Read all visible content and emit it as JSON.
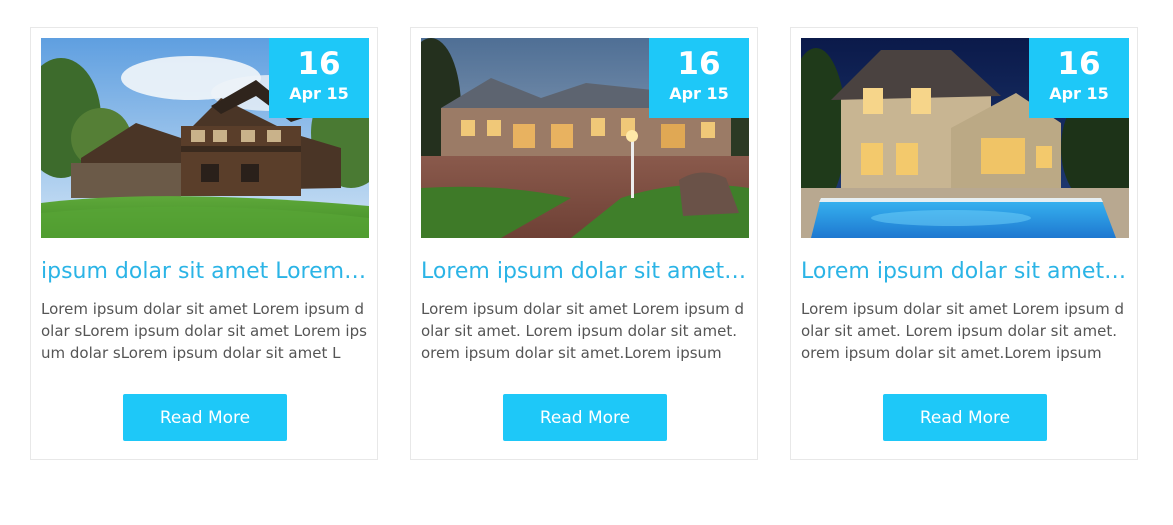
{
  "accent_color": "#1ec8f8",
  "posts": [
    {
      "date_day": "16",
      "date_month": "Apr 15",
      "title": "ipsum dolar sit amet Lorem ipsum dolar",
      "excerpt": "Lorem ipsum dolar sit amet Lorem ipsum dolar sLorem ipsum dolar sit amet Lorem ipsum dolar sLorem ipsum dolar sit amet L",
      "button_label": "Read More"
    },
    {
      "date_day": "16",
      "date_month": "Apr 15",
      "title": "Lorem ipsum dolar sit amet Lorem ipsum",
      "excerpt": "Lorem ipsum dolar sit amet Lorem ipsum dolar sit amet. Lorem ipsum dolar sit amet. orem ipsum dolar sit amet.Lorem ipsum",
      "button_label": "Read More"
    },
    {
      "date_day": "16",
      "date_month": "Apr 15",
      "title": "Lorem ipsum dolar sit amet Lorem ipsum",
      "excerpt": "Lorem ipsum dolar sit amet Lorem ipsum dolar sit amet. Lorem ipsum dolar sit amet. orem ipsum dolar sit amet.Lorem ipsum",
      "button_label": "Read More"
    }
  ]
}
